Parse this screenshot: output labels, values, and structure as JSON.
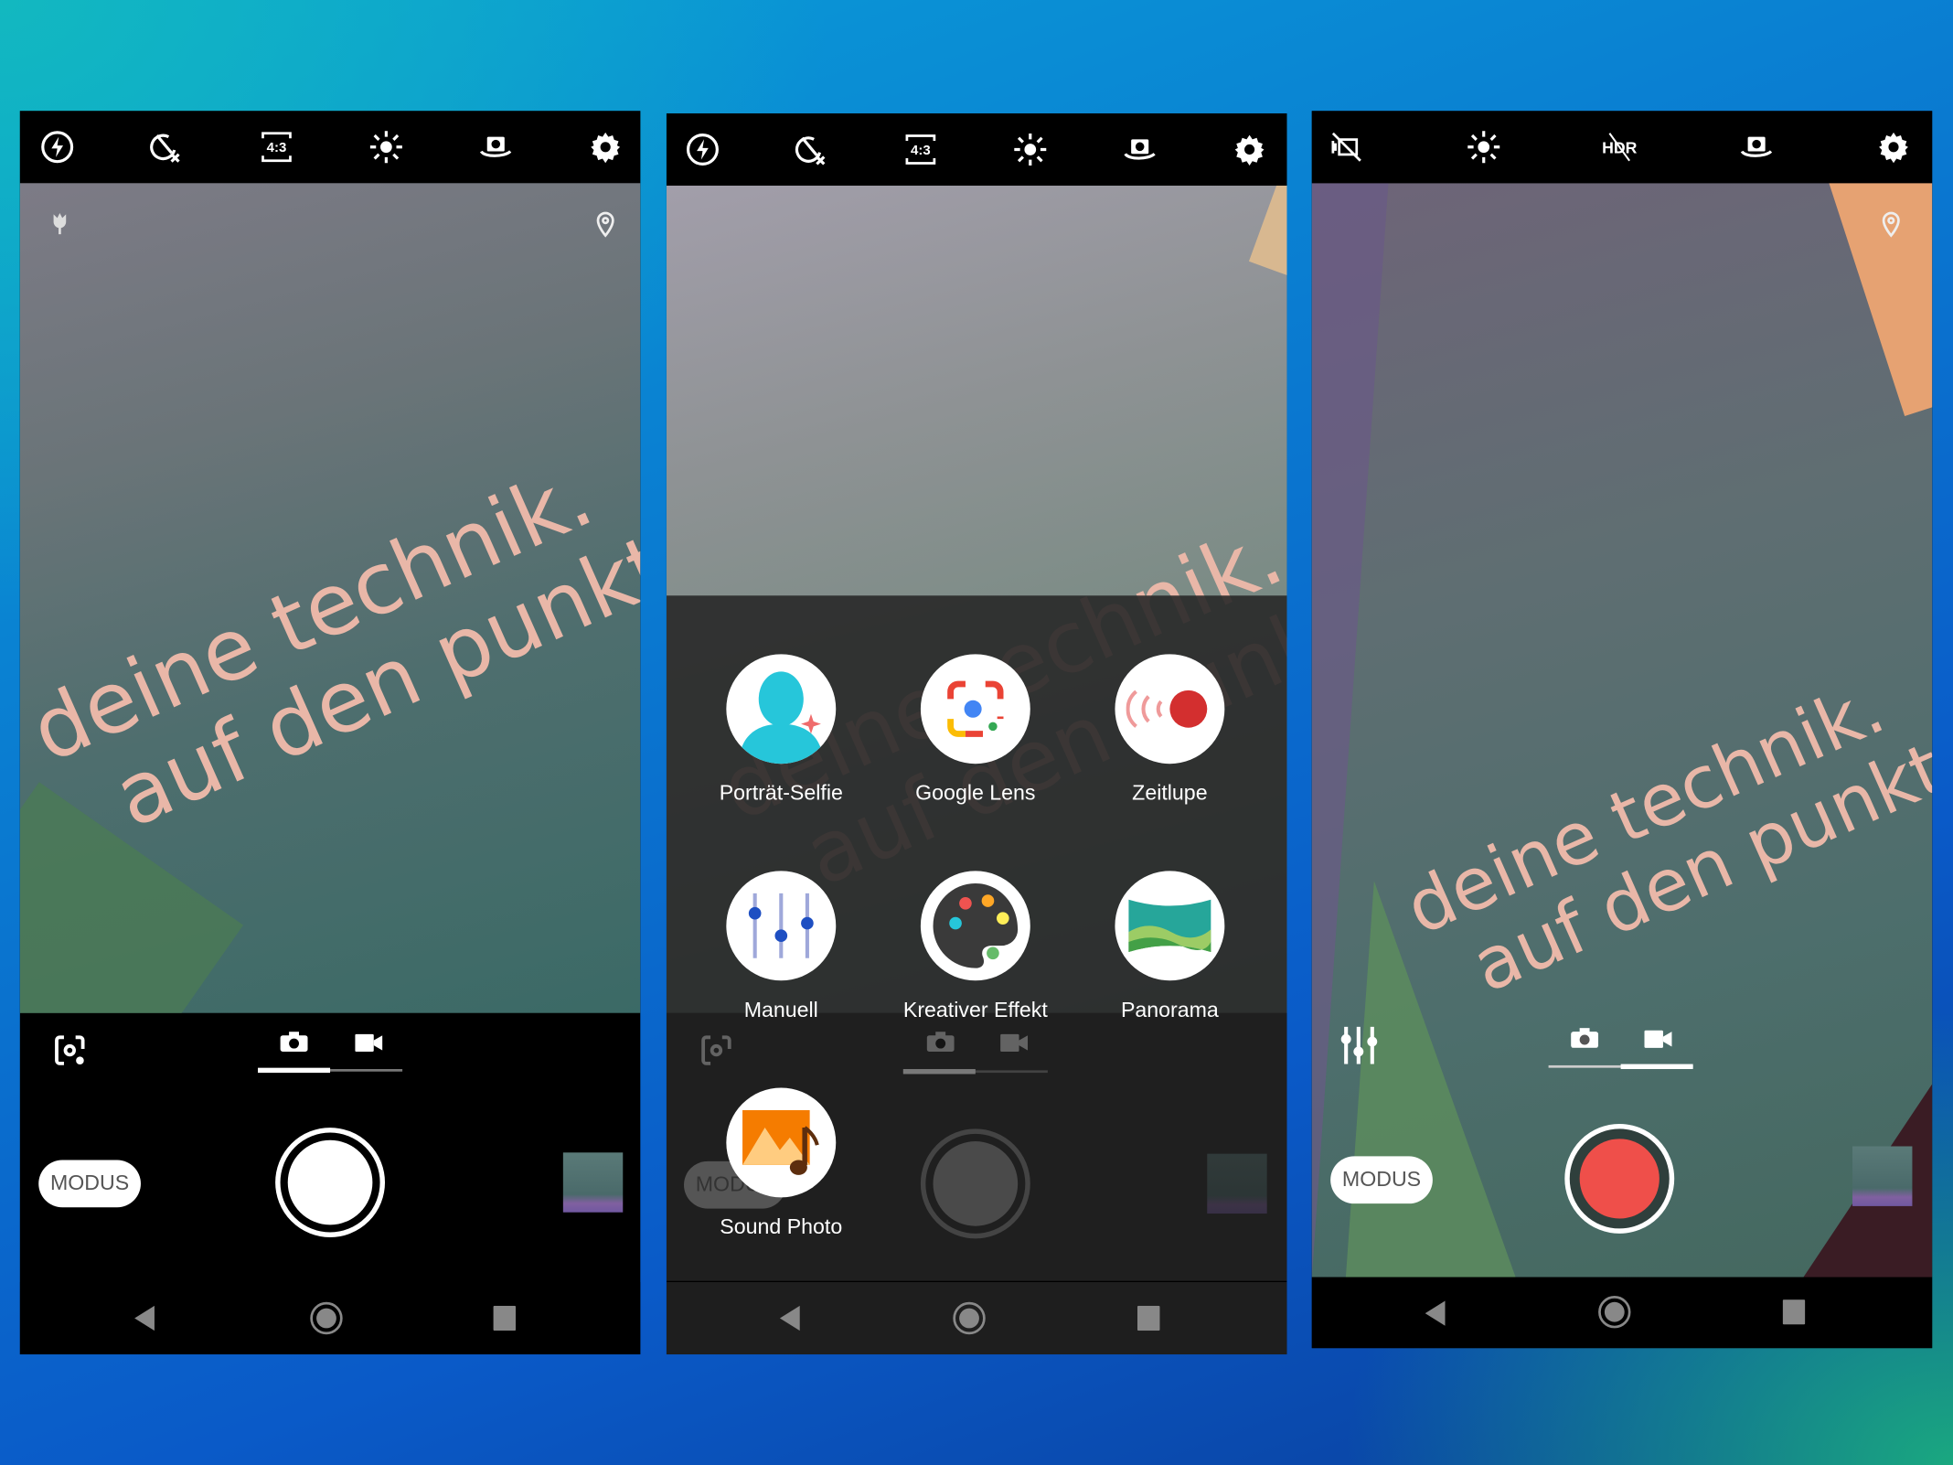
{
  "slogan": {
    "line1": "deine technik.",
    "line2": "auf den punkt",
    "line2_panel3": "auf den punkt."
  },
  "panel1": {
    "top_icons": [
      "flash-auto-icon",
      "timer-off-icon",
      "aspect-ratio-icon",
      "exposure-icon",
      "switch-camera-icon",
      "settings-icon"
    ],
    "aspect_label": "4:3",
    "mode_label": "MODUS",
    "active_tab": "photo"
  },
  "panel2": {
    "aspect_label": "4:3",
    "mode_label": "MODUS",
    "modes": [
      {
        "label": "Porträt-Selfie",
        "icon": "portrait-selfie-icon"
      },
      {
        "label": "Google Lens",
        "icon": "google-lens-icon"
      },
      {
        "label": "Zeitlupe",
        "icon": "slow-motion-icon"
      },
      {
        "label": "Manuell",
        "icon": "manual-sliders-icon"
      },
      {
        "label": "Kreativer Effekt",
        "icon": "palette-icon"
      },
      {
        "label": "Panorama",
        "icon": "panorama-icon"
      },
      {
        "label": "Sound Photo",
        "icon": "sound-photo-icon"
      }
    ]
  },
  "panel3": {
    "top_icons": [
      "video-stabilization-off-icon",
      "exposure-icon",
      "hdr-off-icon",
      "switch-camera-icon",
      "settings-icon"
    ],
    "hdr_label": "HDR",
    "mode_label": "MODUS",
    "active_tab": "video"
  },
  "colors": {
    "record": "#ef4f4a",
    "slogan": "#e9b7a8",
    "overlay": "#2b2b2b"
  }
}
